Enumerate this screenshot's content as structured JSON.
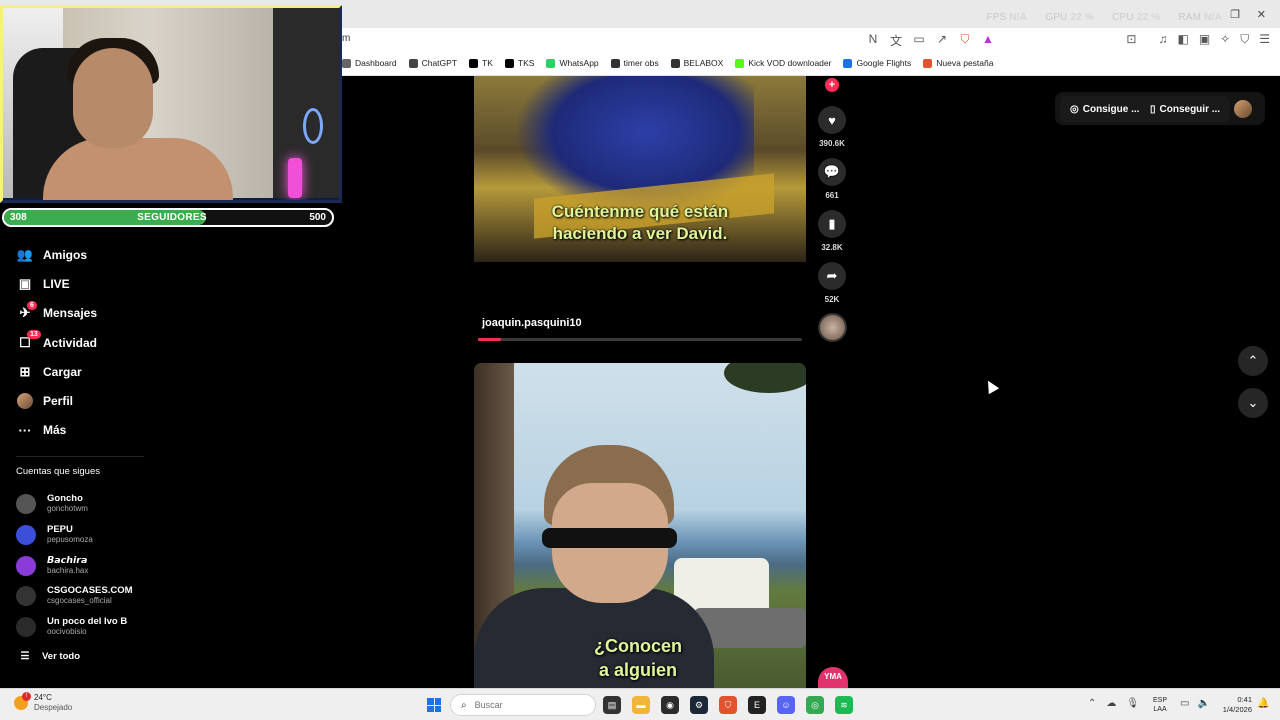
{
  "overlay_stats": {
    "fps_label": "FPS",
    "fps": "N/A",
    "gpu_label": "GPU",
    "gpu": "22 %",
    "cpu_label": "CPU",
    "cpu": "22 %",
    "ram_label": "RAM",
    "ram": "N/A"
  },
  "browser": {
    "url_fragment": "m",
    "bookmarks": [
      {
        "label": "Dashboard",
        "icon": "dashboard-icon",
        "color": "#666666"
      },
      {
        "label": "ChatGPT",
        "icon": "chatgpt-icon",
        "color": "#444444"
      },
      {
        "label": "TK",
        "icon": "tiktok-icon",
        "color": "#000000"
      },
      {
        "label": "TKS",
        "icon": "tiktok-icon",
        "color": "#000000"
      },
      {
        "label": "WhatsApp",
        "icon": "whatsapp-icon",
        "color": "#25d366"
      },
      {
        "label": "timer obs",
        "icon": "obs-icon",
        "color": "#333333"
      },
      {
        "label": "BELABOX",
        "icon": "belabox-icon",
        "color": "#333333"
      },
      {
        "label": "Kick VOD downloader",
        "icon": "kick-icon",
        "color": "#53fc18"
      },
      {
        "label": "Google Flights",
        "icon": "flights-icon",
        "color": "#1a73e8"
      },
      {
        "label": "Nueva pestaña",
        "icon": "brave-icon",
        "color": "#e2532e"
      }
    ]
  },
  "followers_goal": {
    "current": "308",
    "label": "SEGUIDORES",
    "goal": "500",
    "fraction": 0.616
  },
  "sidebar": {
    "nav": [
      {
        "label": "Amigos",
        "icon": "friends-icon",
        "glyph": "👥",
        "badge": ""
      },
      {
        "label": "LIVE",
        "icon": "live-icon",
        "glyph": "▣",
        "badge": ""
      },
      {
        "label": "Mensajes",
        "icon": "messages-icon",
        "glyph": "✈",
        "badge": "6"
      },
      {
        "label": "Actividad",
        "icon": "activity-icon",
        "glyph": "☐",
        "badge": "13"
      },
      {
        "label": "Cargar",
        "icon": "upload-icon",
        "glyph": "⊞",
        "badge": ""
      },
      {
        "label": "Perfil",
        "icon": "profile-avatar",
        "glyph": "",
        "badge": ""
      },
      {
        "label": "Más",
        "icon": "more-icon",
        "glyph": "···",
        "badge": ""
      }
    ],
    "following_title": "Cuentas que sigues",
    "following": [
      {
        "name": "Goncho",
        "user": "gonchotwm",
        "color": "#555555"
      },
      {
        "name": "PEPU",
        "user": "pepusomoza",
        "color": "#3b4fd8"
      },
      {
        "name": "𝘽𝙖𝙘𝙝𝙞𝙧𝙖",
        "user": "bachira.hax",
        "color": "#8a3bd8"
      },
      {
        "name": "CSGOCASES.COM",
        "user": "csgocases_official",
        "color": "#333333"
      },
      {
        "name": "Un poco del Ivo B",
        "user": "oocivobisio",
        "color": "#2a2a2a"
      }
    ],
    "see_all": "Ver todo"
  },
  "video1": {
    "caption_line1": "Cuéntenme qué están",
    "caption_line2": "haciendo a ver David.",
    "username": "joaquin.pasquini10",
    "progress": 0.07
  },
  "actions": {
    "likes": "390.6K",
    "comments": "661",
    "saves": "32.8K",
    "shares": "52K"
  },
  "video2": {
    "caption_line1": "¿Conocen",
    "caption_line2": "a alguien"
  },
  "top_right": {
    "coins_label": "Consigue ...",
    "app_label": "Conseguir ..."
  },
  "taskbar": {
    "temp": "24°C",
    "weather": "Despejado",
    "search_placeholder": "Buscar",
    "lang_line1": "ESP",
    "lang_line2": "LAA",
    "time": "0:41",
    "date": "1/4/2026"
  }
}
